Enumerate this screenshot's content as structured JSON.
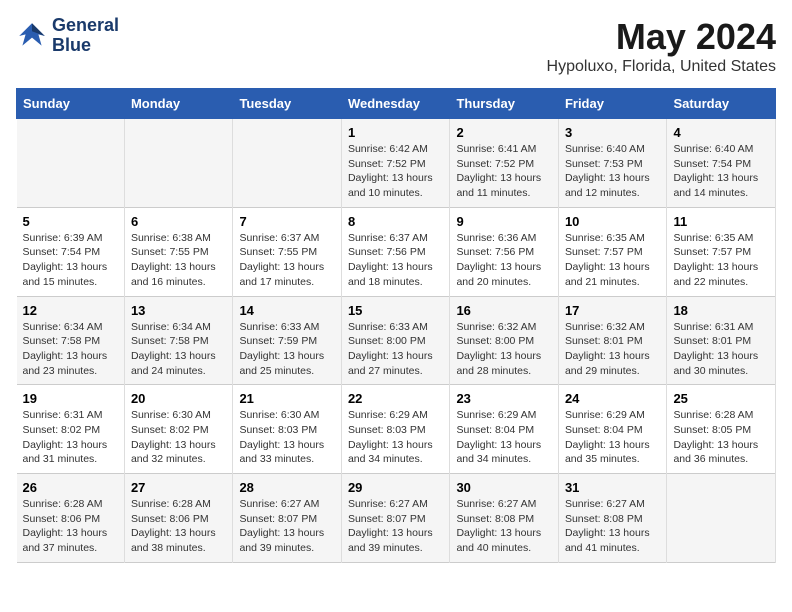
{
  "logo": {
    "line1": "General",
    "line2": "Blue"
  },
  "title": "May 2024",
  "subtitle": "Hypoluxo, Florida, United States",
  "weekdays": [
    "Sunday",
    "Monday",
    "Tuesday",
    "Wednesday",
    "Thursday",
    "Friday",
    "Saturday"
  ],
  "weeks": [
    [
      {
        "day": "",
        "info": ""
      },
      {
        "day": "",
        "info": ""
      },
      {
        "day": "",
        "info": ""
      },
      {
        "day": "1",
        "info": "Sunrise: 6:42 AM\nSunset: 7:52 PM\nDaylight: 13 hours\nand 10 minutes."
      },
      {
        "day": "2",
        "info": "Sunrise: 6:41 AM\nSunset: 7:52 PM\nDaylight: 13 hours\nand 11 minutes."
      },
      {
        "day": "3",
        "info": "Sunrise: 6:40 AM\nSunset: 7:53 PM\nDaylight: 13 hours\nand 12 minutes."
      },
      {
        "day": "4",
        "info": "Sunrise: 6:40 AM\nSunset: 7:54 PM\nDaylight: 13 hours\nand 14 minutes."
      }
    ],
    [
      {
        "day": "5",
        "info": "Sunrise: 6:39 AM\nSunset: 7:54 PM\nDaylight: 13 hours\nand 15 minutes."
      },
      {
        "day": "6",
        "info": "Sunrise: 6:38 AM\nSunset: 7:55 PM\nDaylight: 13 hours\nand 16 minutes."
      },
      {
        "day": "7",
        "info": "Sunrise: 6:37 AM\nSunset: 7:55 PM\nDaylight: 13 hours\nand 17 minutes."
      },
      {
        "day": "8",
        "info": "Sunrise: 6:37 AM\nSunset: 7:56 PM\nDaylight: 13 hours\nand 18 minutes."
      },
      {
        "day": "9",
        "info": "Sunrise: 6:36 AM\nSunset: 7:56 PM\nDaylight: 13 hours\nand 20 minutes."
      },
      {
        "day": "10",
        "info": "Sunrise: 6:35 AM\nSunset: 7:57 PM\nDaylight: 13 hours\nand 21 minutes."
      },
      {
        "day": "11",
        "info": "Sunrise: 6:35 AM\nSunset: 7:57 PM\nDaylight: 13 hours\nand 22 minutes."
      }
    ],
    [
      {
        "day": "12",
        "info": "Sunrise: 6:34 AM\nSunset: 7:58 PM\nDaylight: 13 hours\nand 23 minutes."
      },
      {
        "day": "13",
        "info": "Sunrise: 6:34 AM\nSunset: 7:58 PM\nDaylight: 13 hours\nand 24 minutes."
      },
      {
        "day": "14",
        "info": "Sunrise: 6:33 AM\nSunset: 7:59 PM\nDaylight: 13 hours\nand 25 minutes."
      },
      {
        "day": "15",
        "info": "Sunrise: 6:33 AM\nSunset: 8:00 PM\nDaylight: 13 hours\nand 27 minutes."
      },
      {
        "day": "16",
        "info": "Sunrise: 6:32 AM\nSunset: 8:00 PM\nDaylight: 13 hours\nand 28 minutes."
      },
      {
        "day": "17",
        "info": "Sunrise: 6:32 AM\nSunset: 8:01 PM\nDaylight: 13 hours\nand 29 minutes."
      },
      {
        "day": "18",
        "info": "Sunrise: 6:31 AM\nSunset: 8:01 PM\nDaylight: 13 hours\nand 30 minutes."
      }
    ],
    [
      {
        "day": "19",
        "info": "Sunrise: 6:31 AM\nSunset: 8:02 PM\nDaylight: 13 hours\nand 31 minutes."
      },
      {
        "day": "20",
        "info": "Sunrise: 6:30 AM\nSunset: 8:02 PM\nDaylight: 13 hours\nand 32 minutes."
      },
      {
        "day": "21",
        "info": "Sunrise: 6:30 AM\nSunset: 8:03 PM\nDaylight: 13 hours\nand 33 minutes."
      },
      {
        "day": "22",
        "info": "Sunrise: 6:29 AM\nSunset: 8:03 PM\nDaylight: 13 hours\nand 34 minutes."
      },
      {
        "day": "23",
        "info": "Sunrise: 6:29 AM\nSunset: 8:04 PM\nDaylight: 13 hours\nand 34 minutes."
      },
      {
        "day": "24",
        "info": "Sunrise: 6:29 AM\nSunset: 8:04 PM\nDaylight: 13 hours\nand 35 minutes."
      },
      {
        "day": "25",
        "info": "Sunrise: 6:28 AM\nSunset: 8:05 PM\nDaylight: 13 hours\nand 36 minutes."
      }
    ],
    [
      {
        "day": "26",
        "info": "Sunrise: 6:28 AM\nSunset: 8:06 PM\nDaylight: 13 hours\nand 37 minutes."
      },
      {
        "day": "27",
        "info": "Sunrise: 6:28 AM\nSunset: 8:06 PM\nDaylight: 13 hours\nand 38 minutes."
      },
      {
        "day": "28",
        "info": "Sunrise: 6:27 AM\nSunset: 8:07 PM\nDaylight: 13 hours\nand 39 minutes."
      },
      {
        "day": "29",
        "info": "Sunrise: 6:27 AM\nSunset: 8:07 PM\nDaylight: 13 hours\nand 39 minutes."
      },
      {
        "day": "30",
        "info": "Sunrise: 6:27 AM\nSunset: 8:08 PM\nDaylight: 13 hours\nand 40 minutes."
      },
      {
        "day": "31",
        "info": "Sunrise: 6:27 AM\nSunset: 8:08 PM\nDaylight: 13 hours\nand 41 minutes."
      },
      {
        "day": "",
        "info": ""
      }
    ]
  ]
}
